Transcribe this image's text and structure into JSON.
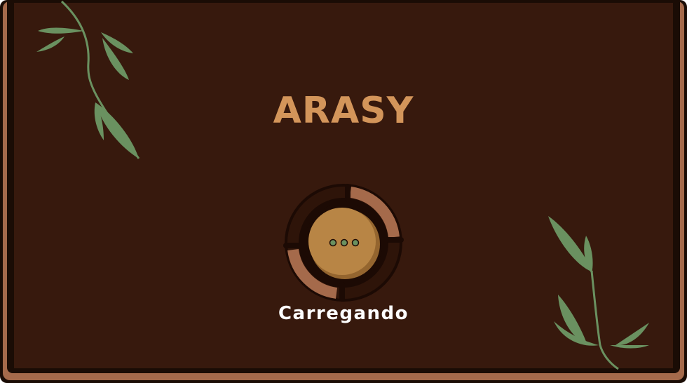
{
  "app": {
    "title": "ARASY"
  },
  "loader": {
    "status_text": "Carregando"
  },
  "colors": {
    "background": "#37190d",
    "title": "#d3955a",
    "rim": "#a56a4b",
    "leaf": "#6a9160",
    "spinner_core": "#b88545"
  },
  "icons": [
    "leaf-vine-icon",
    "loading-dots-icon"
  ]
}
